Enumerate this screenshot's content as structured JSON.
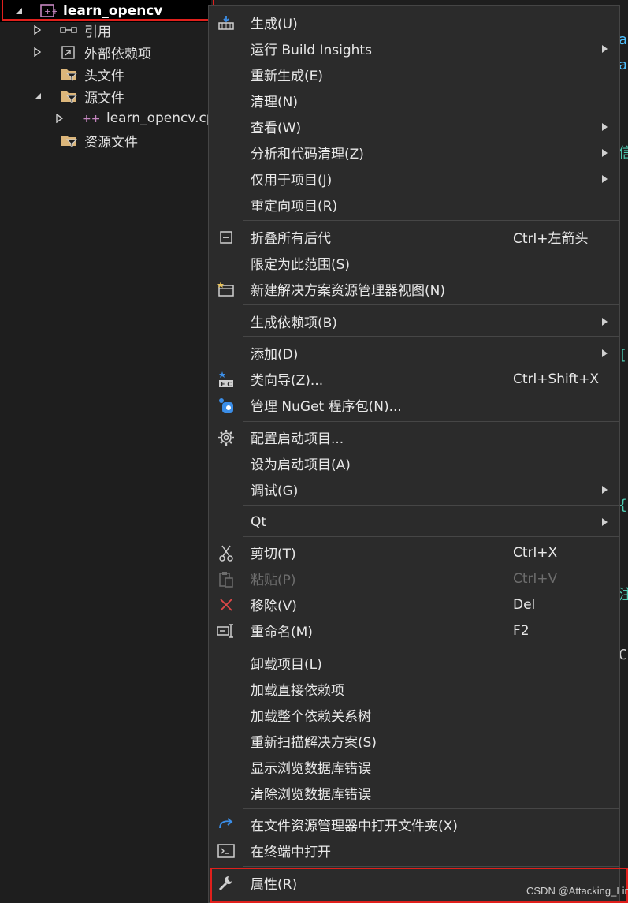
{
  "tree": {
    "project": "learn_opencv",
    "items": [
      {
        "label": "引用"
      },
      {
        "label": "外部依赖项"
      },
      {
        "label": "头文件"
      },
      {
        "label": "源文件"
      },
      {
        "label": "learn_opencv.cpp"
      },
      {
        "label": "资源文件"
      }
    ]
  },
  "menu": {
    "items": [
      {
        "label": "生成(U)",
        "icon": "build-icon"
      },
      {
        "label": "运行 Build Insights",
        "submenu": true
      },
      {
        "label": "重新生成(E)"
      },
      {
        "label": "清理(N)"
      },
      {
        "label": "查看(W)",
        "submenu": true
      },
      {
        "label": "分析和代码清理(Z)",
        "submenu": true
      },
      {
        "label": "仅用于项目(J)",
        "submenu": true
      },
      {
        "label": "重定向项目(R)"
      },
      {
        "label": "折叠所有后代",
        "shortcut": "Ctrl+左箭头",
        "icon": "collapse-icon"
      },
      {
        "label": "限定为此范围(S)"
      },
      {
        "label": "新建解决方案资源管理器视图(N)",
        "icon": "new-view-icon"
      },
      {
        "label": "生成依赖项(B)",
        "submenu": true
      },
      {
        "label": "添加(D)",
        "submenu": true
      },
      {
        "label": "类向导(Z)...",
        "shortcut": "Ctrl+Shift+X",
        "icon": "class-wizard-icon"
      },
      {
        "label": "管理 NuGet 程序包(N)...",
        "icon": "nuget-icon"
      },
      {
        "label": "配置启动项目...",
        "icon": "gear-icon"
      },
      {
        "label": "设为启动项目(A)"
      },
      {
        "label": "调试(G)",
        "submenu": true
      },
      {
        "label": "Qt",
        "submenu": true
      },
      {
        "label": "剪切(T)",
        "shortcut": "Ctrl+X",
        "icon": "scissors-icon"
      },
      {
        "label": "粘贴(P)",
        "shortcut": "Ctrl+V",
        "icon": "paste-icon",
        "disabled": true
      },
      {
        "label": "移除(V)",
        "shortcut": "Del",
        "icon": "remove-icon"
      },
      {
        "label": "重命名(M)",
        "shortcut": "F2",
        "icon": "rename-icon"
      },
      {
        "label": "卸载项目(L)"
      },
      {
        "label": "加载直接依赖项"
      },
      {
        "label": "加载整个依赖关系树"
      },
      {
        "label": "重新扫描解决方案(S)"
      },
      {
        "label": "显示浏览数据库错误"
      },
      {
        "label": "清除浏览数据库错误"
      },
      {
        "label": "在文件资源管理器中打开文件夹(X)",
        "icon": "open-folder-icon"
      },
      {
        "label": "在终端中打开",
        "icon": "terminal-icon"
      },
      {
        "label": "属性(R)",
        "icon": "wrench-icon"
      }
    ]
  },
  "colors": {
    "highlight": "#e0201c",
    "menu_bg": "#2b2b2b",
    "folder": "#dcb67a",
    "cpp_icon": "#c586c0",
    "remove": "#e04848",
    "accent_blue": "#3b8ee8"
  },
  "watermark": "CSDN @Attacking_Lin"
}
